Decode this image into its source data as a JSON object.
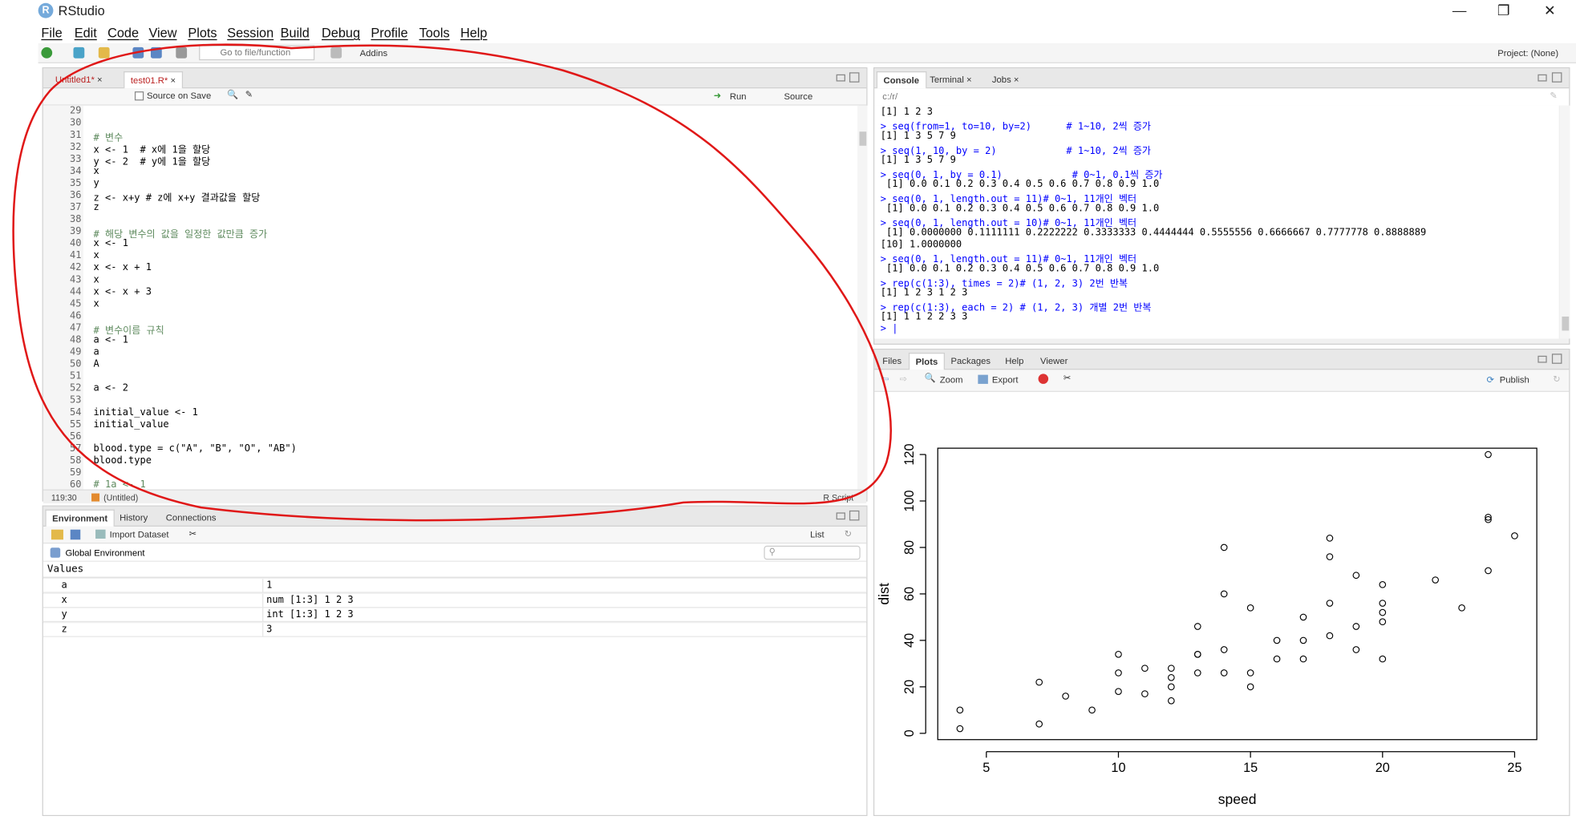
{
  "window": {
    "title": "RStudio",
    "logo_letter": "R",
    "minimize": "—",
    "maximize": "❐",
    "close": "✕"
  },
  "menu": [
    "File",
    "Edit",
    "Code",
    "View",
    "Plots",
    "Session",
    "Build",
    "Debug",
    "Profile",
    "Tools",
    "Help"
  ],
  "toolbar": {
    "goto_placeholder": "Go to file/function",
    "addins": "Addins",
    "project": "Project: (None)"
  },
  "editor": {
    "tabs": [
      "Untitled1*",
      "test01.R*"
    ],
    "source_on_save": "Source on Save",
    "run": "Run",
    "source": "Source",
    "cursor_pos": "119:30",
    "scope": "(Untitled)",
    "file_type": "R Script",
    "lines": [
      {
        "n": "29",
        "t": ""
      },
      {
        "n": "30",
        "t": ""
      },
      {
        "n": "31",
        "t": "# 변수"
      },
      {
        "n": "32",
        "t": "x <- 1  # x에 1을 할당"
      },
      {
        "n": "33",
        "t": "y <- 2  # y에 1을 할당"
      },
      {
        "n": "34",
        "t": "x"
      },
      {
        "n": "35",
        "t": "y"
      },
      {
        "n": "36",
        "t": "z <- x+y # z에 x+y 결과값을 할당"
      },
      {
        "n": "37",
        "t": "z"
      },
      {
        "n": "38",
        "t": ""
      },
      {
        "n": "39",
        "t": "# 해당 변수의 값을 일정한 값만큼 증가"
      },
      {
        "n": "40",
        "t": "x <- 1"
      },
      {
        "n": "41",
        "t": "x"
      },
      {
        "n": "42",
        "t": "x <- x + 1"
      },
      {
        "n": "43",
        "t": "x"
      },
      {
        "n": "44",
        "t": "x <- x + 3"
      },
      {
        "n": "45",
        "t": "x"
      },
      {
        "n": "46",
        "t": ""
      },
      {
        "n": "47",
        "t": "# 변수이름 규칙"
      },
      {
        "n": "48",
        "t": "a <- 1"
      },
      {
        "n": "49",
        "t": "a"
      },
      {
        "n": "50",
        "t": "A"
      },
      {
        "n": "51",
        "t": ""
      },
      {
        "n": "52",
        "t": "a <- 2"
      },
      {
        "n": "53",
        "t": ""
      },
      {
        "n": "54",
        "t": "initial_value <- 1"
      },
      {
        "n": "55",
        "t": "initial_value"
      },
      {
        "n": "56",
        "t": ""
      },
      {
        "n": "57",
        "t": "blood.type = c(\"A\", \"B\", \"O\", \"AB\")"
      },
      {
        "n": "58",
        "t": "blood.type"
      },
      {
        "n": "59",
        "t": ""
      },
      {
        "n": "60",
        "t": "# 1a <- 1"
      }
    ]
  },
  "environment": {
    "tabs": [
      "Environment",
      "History",
      "Connections"
    ],
    "import_dataset": "Import Dataset",
    "list_view": "List",
    "scope": "Global Environment",
    "section": "Values",
    "rows": [
      {
        "name": "a",
        "value": "1"
      },
      {
        "name": "x",
        "value": "num [1:3] 1 2 3"
      },
      {
        "name": "y",
        "value": "int [1:3] 1 2 3"
      },
      {
        "name": "z",
        "value": "3"
      }
    ]
  },
  "console": {
    "tabs": [
      "Console",
      "Terminal",
      "Jobs"
    ],
    "path": "c:/r/",
    "lines": [
      {
        "k": "out",
        "t": "[1] 1 2 3"
      },
      {
        "k": "cmd",
        "t": "> seq(from=1, to=10, by=2)      # 1~10, 2씩 증가"
      },
      {
        "k": "out",
        "t": "[1] 1 3 5 7 9"
      },
      {
        "k": "cmd",
        "t": "> seq(1, 10, by = 2)            # 1~10, 2씩 증가"
      },
      {
        "k": "out",
        "t": "[1] 1 3 5 7 9"
      },
      {
        "k": "cmd",
        "t": "> seq(0, 1, by = 0.1)            # 0~1, 0.1씩 증가"
      },
      {
        "k": "out",
        "t": " [1] 0.0 0.1 0.2 0.3 0.4 0.5 0.6 0.7 0.8 0.9 1.0"
      },
      {
        "k": "cmd",
        "t": "> seq(0, 1, length.out = 11)# 0~1, 11개인 벡터"
      },
      {
        "k": "out",
        "t": " [1] 0.0 0.1 0.2 0.3 0.4 0.5 0.6 0.7 0.8 0.9 1.0"
      },
      {
        "k": "cmd",
        "t": "> seq(0, 1, length.out = 10)# 0~1, 11개인 벡터"
      },
      {
        "k": "out",
        "t": " [1] 0.0000000 0.1111111 0.2222222 0.3333333 0.4444444 0.5555556 0.6666667 0.7777778 0.8888889"
      },
      {
        "k": "out",
        "t": "[10] 1.0000000"
      },
      {
        "k": "cmd",
        "t": "> seq(0, 1, length.out = 11)# 0~1, 11개인 벡터"
      },
      {
        "k": "out",
        "t": " [1] 0.0 0.1 0.2 0.3 0.4 0.5 0.6 0.7 0.8 0.9 1.0"
      },
      {
        "k": "cmd",
        "t": "> rep(c(1:3), times = 2)# (1, 2, 3) 2번 반복"
      },
      {
        "k": "out",
        "t": "[1] 1 2 3 1 2 3"
      },
      {
        "k": "cmd",
        "t": "> rep(c(1:3), each = 2) # (1, 2, 3) 개별 2번 반복"
      },
      {
        "k": "out",
        "t": "[1] 1 1 2 2 3 3"
      },
      {
        "k": "cmd",
        "t": "> |"
      }
    ]
  },
  "files_pane": {
    "tabs": [
      "Files",
      "Plots",
      "Packages",
      "Help",
      "Viewer"
    ],
    "zoom": "Zoom",
    "export": "Export",
    "publish": "Publish"
  },
  "chart_data": {
    "type": "scatter",
    "xlabel": "speed",
    "ylabel": "dist",
    "xticks": [
      5,
      10,
      15,
      20,
      25
    ],
    "yticks": [
      0,
      20,
      40,
      60,
      80,
      100,
      120
    ],
    "xlim": [
      3.16,
      25.84
    ],
    "ylim": [
      -2.72,
      122.72
    ],
    "points": [
      [
        4,
        2
      ],
      [
        4,
        10
      ],
      [
        7,
        4
      ],
      [
        7,
        22
      ],
      [
        8,
        16
      ],
      [
        9,
        10
      ],
      [
        10,
        18
      ],
      [
        10,
        26
      ],
      [
        10,
        34
      ],
      [
        11,
        17
      ],
      [
        11,
        28
      ],
      [
        12,
        14
      ],
      [
        12,
        20
      ],
      [
        12,
        24
      ],
      [
        12,
        28
      ],
      [
        13,
        26
      ],
      [
        13,
        34
      ],
      [
        13,
        34
      ],
      [
        13,
        46
      ],
      [
        14,
        26
      ],
      [
        14,
        36
      ],
      [
        14,
        60
      ],
      [
        14,
        80
      ],
      [
        15,
        20
      ],
      [
        15,
        26
      ],
      [
        15,
        54
      ],
      [
        16,
        32
      ],
      [
        16,
        40
      ],
      [
        17,
        32
      ],
      [
        17,
        40
      ],
      [
        17,
        50
      ],
      [
        18,
        42
      ],
      [
        18,
        56
      ],
      [
        18,
        76
      ],
      [
        18,
        84
      ],
      [
        19,
        36
      ],
      [
        19,
        46
      ],
      [
        19,
        68
      ],
      [
        20,
        32
      ],
      [
        20,
        48
      ],
      [
        20,
        52
      ],
      [
        20,
        56
      ],
      [
        20,
        64
      ],
      [
        22,
        66
      ],
      [
        23,
        54
      ],
      [
        24,
        70
      ],
      [
        24,
        92
      ],
      [
        24,
        93
      ],
      [
        24,
        120
      ],
      [
        25,
        85
      ]
    ]
  }
}
